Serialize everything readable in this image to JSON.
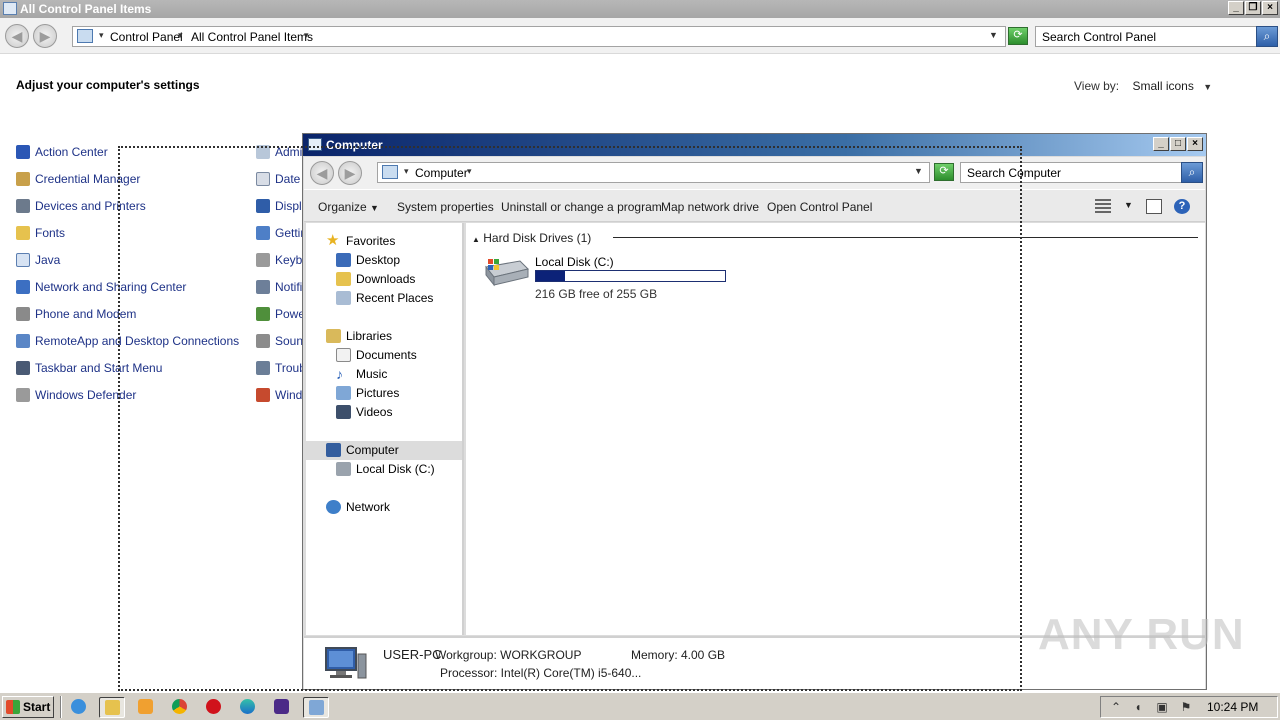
{
  "control_panel": {
    "title": "All Control Panel Items",
    "address": {
      "crumbs": [
        "Control Panel",
        "All Control Panel Items"
      ]
    },
    "search_placeholder": "Search Control Panel",
    "heading": "Adjust your computer's settings",
    "view_by_label": "View by:",
    "view_by_value": "Small icons",
    "items_col1": [
      {
        "label": "Action Center",
        "icon": "flag-icon"
      },
      {
        "label": "Credential Manager",
        "icon": "vault-icon"
      },
      {
        "label": "Devices and Printers",
        "icon": "printer-icon"
      },
      {
        "label": "Fonts",
        "icon": "fonts-folder-icon"
      },
      {
        "label": "Java",
        "icon": "java-icon"
      },
      {
        "label": "Network and Sharing Center",
        "icon": "network-icon"
      },
      {
        "label": "Phone and Modem",
        "icon": "phone-icon"
      },
      {
        "label": "RemoteApp and Desktop Connections",
        "icon": "remote-desktop-icon"
      },
      {
        "label": "Taskbar and Start Menu",
        "icon": "taskbar-icon"
      },
      {
        "label": "Windows Defender",
        "icon": "defender-icon"
      }
    ],
    "items_col2": [
      {
        "label": "Admir",
        "icon": "admin-tools-icon"
      },
      {
        "label": "Date",
        "icon": "calendar-icon"
      },
      {
        "label": "Displa",
        "icon": "display-icon"
      },
      {
        "label": "Gettir",
        "icon": "getting-started-icon"
      },
      {
        "label": "Keybo",
        "icon": "keyboard-icon"
      },
      {
        "label": "Notifi",
        "icon": "notification-icon"
      },
      {
        "label": "Powe",
        "icon": "power-icon"
      },
      {
        "label": "Sound",
        "icon": "sound-icon"
      },
      {
        "label": "Troub",
        "icon": "troubleshoot-icon"
      },
      {
        "label": "Windo",
        "icon": "windows-update-icon"
      }
    ]
  },
  "computer_window": {
    "title": "Computer",
    "address_crumb": "Computer",
    "search_placeholder": "Search Computer",
    "toolbar": {
      "organize": "Organize",
      "system_properties": "System properties",
      "uninstall": "Uninstall or change a program",
      "map_drive": "Map network drive",
      "open_cp": "Open Control Panel"
    },
    "nav": {
      "favorites": "Favorites",
      "desktop": "Desktop",
      "downloads": "Downloads",
      "recent": "Recent Places",
      "libraries": "Libraries",
      "documents": "Documents",
      "music": "Music",
      "pictures": "Pictures",
      "videos": "Videos",
      "computer": "Computer",
      "local_disk": "Local Disk (C:)",
      "network": "Network"
    },
    "group_header": "Hard Disk Drives (1)",
    "drive": {
      "name": "Local Disk (C:)",
      "free_text": "216 GB free of 255 GB",
      "used_fraction": 0.153
    },
    "details": {
      "pc_name": "USER-PC",
      "workgroup": "Workgroup: WORKGROUP",
      "memory": "Memory: 4.00 GB",
      "processor": "Processor: Intel(R) Core(TM) i5-640..."
    }
  },
  "taskbar": {
    "start_label": "Start",
    "clock": "10:24 PM"
  },
  "watermark": "ANY RUN",
  "colors": {
    "selection_blue": "#0c2278",
    "link_blue": "#1e3287",
    "title_active": "#0a246a"
  }
}
